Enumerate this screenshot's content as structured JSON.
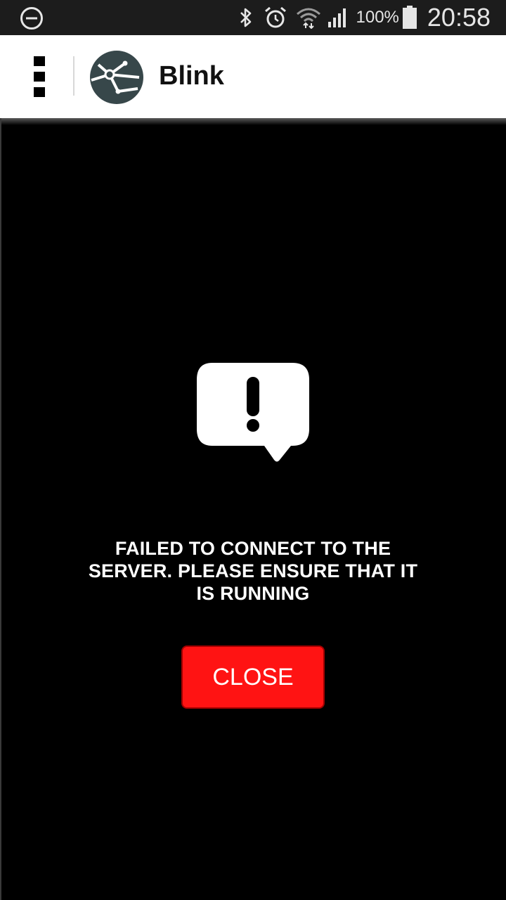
{
  "status_bar": {
    "battery_percent": "100%",
    "time": "20:58",
    "icons": [
      "do-not-disturb-icon",
      "bluetooth-icon",
      "alarm-icon",
      "wifi-icon",
      "signal-icon",
      "battery-icon"
    ]
  },
  "app_bar": {
    "title": "Blink",
    "menu_icon": "overflow-menu-icon",
    "logo_icon": "blink-logo-icon"
  },
  "error": {
    "icon": "alert-speech-bubble-icon",
    "message": "FAILED TO CONNECT TO THE SERVER. PLEASE ENSURE THAT IT IS RUNNING",
    "close_label": "CLOSE"
  },
  "colors": {
    "background": "#000000",
    "app_bar": "#ffffff",
    "status_bar": "#1c1c1c",
    "close_button": "#ff1313",
    "logo": "#37474a"
  }
}
